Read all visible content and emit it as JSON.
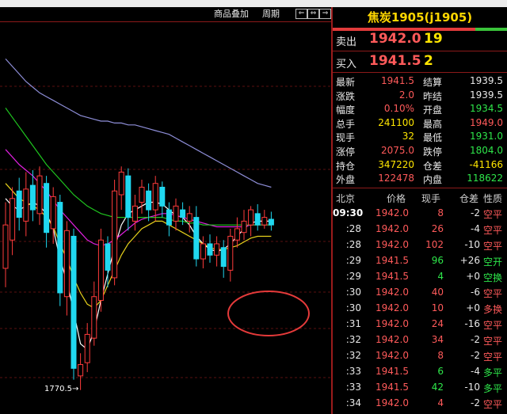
{
  "toolbar": {
    "overlay_label": "商品叠加",
    "period_label": "周期"
  },
  "chart_annotation": {
    "low_label": "1770.5"
  },
  "quote": {
    "title": "焦炭1905(j1905)",
    "sell_label": "卖出",
    "sell_price": "1942.0",
    "sell_volume": "19",
    "buy_label": "买入",
    "buy_price": "1941.5",
    "buy_volume": "2"
  },
  "stats": [
    {
      "label": "最新",
      "value": "1941.5",
      "label2": "结算",
      "value2": "1939.5",
      "c1": "red",
      "c2": "white"
    },
    {
      "label": "涨跌",
      "value": "2.0",
      "label2": "昨结",
      "value2": "1939.5",
      "c1": "red",
      "c2": "white"
    },
    {
      "label": "幅度",
      "value": "0.10%",
      "label2": "开盘",
      "value2": "1934.5",
      "c1": "red",
      "c2": "green"
    },
    {
      "label": "总手",
      "value": "241100",
      "label2": "最高",
      "value2": "1949.0",
      "c1": "yellow",
      "c2": "red"
    },
    {
      "label": "现手",
      "value": "32",
      "label2": "最低",
      "value2": "1931.0",
      "c1": "yellow",
      "c2": "green"
    },
    {
      "label": "涨停",
      "value": "2075.0",
      "label2": "跌停",
      "value2": "1804.0",
      "c1": "red",
      "c2": "green"
    },
    {
      "label": "持仓",
      "value": "347220",
      "label2": "仓差",
      "value2": "-41166",
      "c1": "yellow",
      "c2": "yellow"
    },
    {
      "label": "外盘",
      "value": "122478",
      "label2": "内盘",
      "value2": "118622",
      "c1": "red",
      "c2": "green"
    }
  ],
  "ticks_header": {
    "time": "北京",
    "price": "价格",
    "vol": "现手",
    "oi": "仓差",
    "nature": "性质"
  },
  "ticks": [
    {
      "time": "09:30",
      "price": "1942.0",
      "vol": "8",
      "oi": "-2",
      "nature": "空平",
      "pc": "red",
      "vc": "red",
      "oc": "white",
      "nc": "red"
    },
    {
      "time": ":28",
      "price": "1942.0",
      "vol": "26",
      "oi": "-4",
      "nature": "空平",
      "pc": "red",
      "vc": "red",
      "oc": "white",
      "nc": "red"
    },
    {
      "time": ":28",
      "price": "1942.0",
      "vol": "102",
      "oi": "-10",
      "nature": "空平",
      "pc": "red",
      "vc": "red",
      "oc": "white",
      "nc": "red"
    },
    {
      "time": ":29",
      "price": "1941.5",
      "vol": "96",
      "oi": "+26",
      "nature": "空开",
      "pc": "red",
      "vc": "green",
      "oc": "white",
      "nc": "green"
    },
    {
      "time": ":29",
      "price": "1941.5",
      "vol": "4",
      "oi": "+0",
      "nature": "空换",
      "pc": "red",
      "vc": "green",
      "oc": "white",
      "nc": "green"
    },
    {
      "time": ":30",
      "price": "1942.0",
      "vol": "40",
      "oi": "-6",
      "nature": "空平",
      "pc": "red",
      "vc": "red",
      "oc": "white",
      "nc": "red"
    },
    {
      "time": ":30",
      "price": "1942.0",
      "vol": "10",
      "oi": "+0",
      "nature": "多换",
      "pc": "red",
      "vc": "red",
      "oc": "white",
      "nc": "red"
    },
    {
      "time": ":31",
      "price": "1942.0",
      "vol": "24",
      "oi": "-16",
      "nature": "空平",
      "pc": "red",
      "vc": "red",
      "oc": "white",
      "nc": "red"
    },
    {
      "time": ":32",
      "price": "1942.0",
      "vol": "34",
      "oi": "-2",
      "nature": "空平",
      "pc": "red",
      "vc": "red",
      "oc": "white",
      "nc": "red"
    },
    {
      "time": ":32",
      "price": "1942.0",
      "vol": "8",
      "oi": "-2",
      "nature": "空平",
      "pc": "red",
      "vc": "red",
      "oc": "white",
      "nc": "red"
    },
    {
      "time": ":33",
      "price": "1941.5",
      "vol": "6",
      "oi": "-4",
      "nature": "多平",
      "pc": "red",
      "vc": "green",
      "oc": "white",
      "nc": "green"
    },
    {
      "time": ":33",
      "price": "1941.5",
      "vol": "42",
      "oi": "-10",
      "nature": "多平",
      "pc": "red",
      "vc": "green",
      "oc": "white",
      "nc": "green"
    },
    {
      "time": ":34",
      "price": "1942.0",
      "vol": "4",
      "oi": "-2",
      "nature": "空平",
      "pc": "red",
      "vc": "red",
      "oc": "white",
      "nc": "red"
    }
  ],
  "candles": [
    {
      "o": 1835,
      "c": 1858,
      "h": 1870,
      "l": 1825
    },
    {
      "o": 1850,
      "c": 1872,
      "h": 1878,
      "l": 1842
    },
    {
      "o": 1876,
      "c": 1862,
      "h": 1883,
      "l": 1855
    },
    {
      "o": 1860,
      "c": 1877,
      "h": 1886,
      "l": 1852
    },
    {
      "o": 1879,
      "c": 1866,
      "h": 1887,
      "l": 1860
    },
    {
      "o": 1864,
      "c": 1884,
      "h": 1889,
      "l": 1858
    },
    {
      "o": 1880,
      "c": 1854,
      "h": 1884,
      "l": 1846
    },
    {
      "o": 1856,
      "c": 1873,
      "h": 1878,
      "l": 1848
    },
    {
      "o": 1870,
      "c": 1822,
      "h": 1874,
      "l": 1815
    },
    {
      "o": 1820,
      "c": 1855,
      "h": 1860,
      "l": 1810
    },
    {
      "o": 1852,
      "c": 1782,
      "h": 1856,
      "l": 1776
    },
    {
      "o": 1778,
      "c": 1784,
      "h": 1790,
      "l": 1770.5
    },
    {
      "o": 1785,
      "c": 1800,
      "h": 1806,
      "l": 1780
    },
    {
      "o": 1798,
      "c": 1820,
      "h": 1828,
      "l": 1794
    },
    {
      "o": 1818,
      "c": 1850,
      "h": 1856,
      "l": 1812
    },
    {
      "o": 1848,
      "c": 1834,
      "h": 1852,
      "l": 1825
    },
    {
      "o": 1830,
      "c": 1876,
      "h": 1882,
      "l": 1826
    },
    {
      "o": 1874,
      "c": 1886,
      "h": 1889,
      "l": 1866
    },
    {
      "o": 1884,
      "c": 1862,
      "h": 1888,
      "l": 1855
    },
    {
      "o": 1860,
      "c": 1868,
      "h": 1874,
      "l": 1855
    },
    {
      "o": 1870,
      "c": 1878,
      "h": 1882,
      "l": 1864
    },
    {
      "o": 1876,
      "c": 1866,
      "h": 1880,
      "l": 1860
    },
    {
      "o": 1866,
      "c": 1880,
      "h": 1884,
      "l": 1860
    },
    {
      "o": 1878,
      "c": 1868,
      "h": 1881,
      "l": 1862
    },
    {
      "o": 1866,
      "c": 1858,
      "h": 1870,
      "l": 1852
    },
    {
      "o": 1860,
      "c": 1868,
      "h": 1872,
      "l": 1855
    },
    {
      "o": 1866,
      "c": 1862,
      "h": 1870,
      "l": 1858
    },
    {
      "o": 1860,
      "c": 1864,
      "h": 1868,
      "l": 1854
    },
    {
      "o": 1862,
      "c": 1840,
      "h": 1868,
      "l": 1836
    },
    {
      "o": 1840,
      "c": 1848,
      "h": 1852,
      "l": 1835
    },
    {
      "o": 1848,
      "c": 1842,
      "h": 1853,
      "l": 1838
    },
    {
      "o": 1842,
      "c": 1848,
      "h": 1852,
      "l": 1836
    },
    {
      "o": 1846,
      "c": 1836,
      "h": 1850,
      "l": 1830
    },
    {
      "o": 1834,
      "c": 1852,
      "h": 1856,
      "l": 1828
    },
    {
      "o": 1850,
      "c": 1856,
      "h": 1862,
      "l": 1846
    },
    {
      "o": 1854,
      "c": 1860,
      "h": 1866,
      "l": 1850
    },
    {
      "o": 1858,
      "c": 1866,
      "h": 1868,
      "l": 1852
    },
    {
      "o": 1864,
      "c": 1858,
      "h": 1869,
      "l": 1855
    },
    {
      "o": 1858,
      "c": 1862,
      "h": 1866,
      "l": 1856
    },
    {
      "o": 1861,
      "c": 1858,
      "h": 1865,
      "l": 1855
    }
  ],
  "ma_lines": {
    "white": [
      1872,
      1868,
      1866,
      1868,
      1870,
      1868,
      1864,
      1856,
      1840,
      1828,
      1812,
      1795,
      1792,
      1802,
      1818,
      1832,
      1846,
      1858,
      1864,
      1866,
      1868,
      1870,
      1870,
      1869,
      1866,
      1863,
      1862,
      1858,
      1852,
      1848,
      1845,
      1844,
      1845,
      1848,
      1852,
      1856,
      1859,
      1860,
      1860,
      1860
    ],
    "yellow": [
      1880,
      1876,
      1872,
      1870,
      1868,
      1866,
      1862,
      1857,
      1848,
      1840,
      1830,
      1822,
      1816,
      1814,
      1818,
      1826,
      1834,
      1842,
      1848,
      1852,
      1856,
      1858,
      1860,
      1860,
      1858,
      1856,
      1854,
      1852,
      1850,
      1848,
      1846,
      1845,
      1845,
      1846,
      1847,
      1849,
      1851,
      1852,
      1852,
      1852
    ],
    "magenta": [
      1898,
      1894,
      1890,
      1887,
      1884,
      1880,
      1876,
      1871,
      1866,
      1862,
      1858,
      1854,
      1850,
      1848,
      1847,
      1848,
      1850,
      1853,
      1856,
      1859,
      1861,
      1862,
      1863,
      1864,
      1864,
      1863,
      1862,
      1861,
      1860,
      1859,
      1858,
      1857,
      1857,
      1857,
      1857,
      1857,
      1858,
      1858,
      1858,
      1858
    ],
    "green": [
      1920,
      1915,
      1910,
      1905,
      1900,
      1895,
      1890,
      1886,
      1882,
      1878,
      1874,
      1871,
      1868,
      1866,
      1864,
      1863,
      1862,
      1862,
      1862,
      1862,
      1862,
      1862,
      1862,
      1862,
      1861,
      1860,
      1860,
      1859,
      1859,
      1858,
      1858,
      1858,
      1858,
      1858,
      1858,
      1858,
      1858,
      1858,
      1858,
      1858
    ],
    "lavender": [
      1946,
      1942,
      1938,
      1934,
      1931,
      1928,
      1926,
      1924,
      1922,
      1920,
      1918,
      1916,
      1915,
      1914,
      1913,
      1913,
      1912,
      1912,
      1911,
      1911,
      1910,
      1909,
      1908,
      1907,
      1906,
      1904,
      1902,
      1900,
      1898,
      1896,
      1894,
      1892,
      1890,
      1888,
      1886,
      1884,
      1882,
      1880,
      1879,
      1878
    ]
  }
}
